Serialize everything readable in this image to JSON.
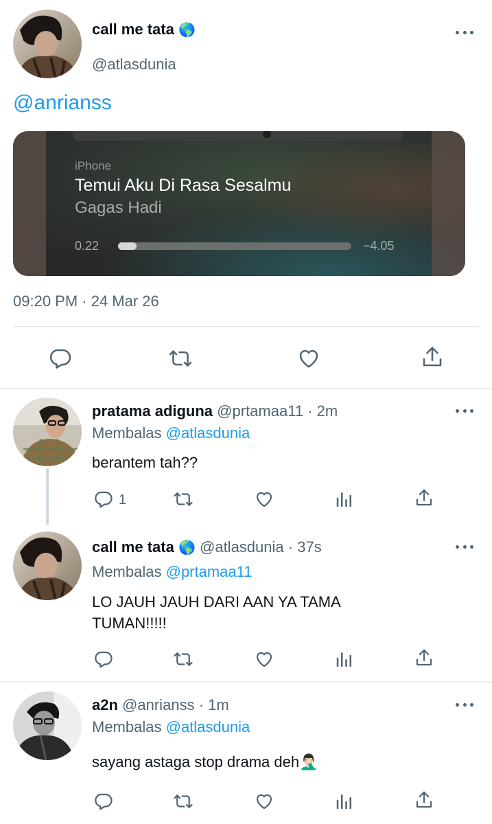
{
  "main_tweet": {
    "display_name": "call me tata",
    "badge": "🌎",
    "handle": "@atlasdunia",
    "mention": "@anrianss",
    "media": {
      "device": "iPhone",
      "song_title": "Temui Aku Di Rasa Sesalmu",
      "artist": "Gagas Hadi",
      "elapsed": "0.22",
      "remaining": "−4.05",
      "progress_fraction": 0.08
    },
    "timestamp": "09:20 PM · 24 Mar 26",
    "icons": [
      "reply-icon",
      "retweet-icon",
      "like-icon",
      "share-icon"
    ]
  },
  "replies": [
    {
      "display_name": "pratama adiguna",
      "handle": "@prtamaa11",
      "time": "· 2m",
      "replying_label": "Membalas",
      "replying_to": "@atlasdunia",
      "text": "berantem tah??",
      "reply_count": "1"
    },
    {
      "display_name": "call me tata",
      "badge": "🌎",
      "handle": "@atlasdunia",
      "time": "· 37s",
      "replying_label": "Membalas",
      "replying_to": "@prtamaa11",
      "text_line1": "LO JAUH JAUH DARI AAN YA TAMA",
      "text_line2": "TUMAN!!!!!"
    },
    {
      "display_name": "a2n",
      "handle": "@anrianss",
      "time": "· 1m",
      "replying_label": "Membalas",
      "replying_to": "@atlasdunia",
      "text": "sayang astaga stop drama deh🤦🏻‍♂️"
    }
  ]
}
